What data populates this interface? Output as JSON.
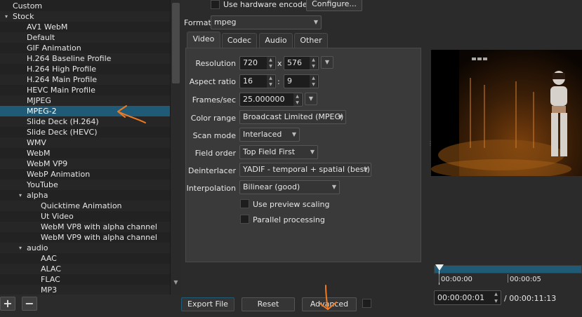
{
  "presets": {
    "items": [
      {
        "label": "Custom",
        "level": 0,
        "arrow": "",
        "selected": false
      },
      {
        "label": "Stock",
        "level": 0,
        "arrow": "▾",
        "selected": false
      },
      {
        "label": "AV1 WebM",
        "level": 1,
        "arrow": "",
        "selected": false
      },
      {
        "label": "Default",
        "level": 1,
        "arrow": "",
        "selected": false
      },
      {
        "label": "GIF Animation",
        "level": 1,
        "arrow": "",
        "selected": false
      },
      {
        "label": "H.264 Baseline Profile",
        "level": 1,
        "arrow": "",
        "selected": false
      },
      {
        "label": "H.264 High Profile",
        "level": 1,
        "arrow": "",
        "selected": false
      },
      {
        "label": "H.264 Main Profile",
        "level": 1,
        "arrow": "",
        "selected": false
      },
      {
        "label": "HEVC Main Profile",
        "level": 1,
        "arrow": "",
        "selected": false
      },
      {
        "label": "MJPEG",
        "level": 1,
        "arrow": "",
        "selected": false
      },
      {
        "label": "MPEG-2",
        "level": 1,
        "arrow": "",
        "selected": true
      },
      {
        "label": "Slide Deck (H.264)",
        "level": 1,
        "arrow": "",
        "selected": false
      },
      {
        "label": "Slide Deck (HEVC)",
        "level": 1,
        "arrow": "",
        "selected": false
      },
      {
        "label": "WMV",
        "level": 1,
        "arrow": "",
        "selected": false
      },
      {
        "label": "WebM",
        "level": 1,
        "arrow": "",
        "selected": false
      },
      {
        "label": "WebM VP9",
        "level": 1,
        "arrow": "",
        "selected": false
      },
      {
        "label": "WebP Animation",
        "level": 1,
        "arrow": "",
        "selected": false
      },
      {
        "label": "YouTube",
        "level": 1,
        "arrow": "",
        "selected": false
      },
      {
        "label": "alpha",
        "level": 1,
        "arrow": "▾",
        "selected": false
      },
      {
        "label": "Quicktime Animation",
        "level": 2,
        "arrow": "",
        "selected": false
      },
      {
        "label": "Ut Video",
        "level": 2,
        "arrow": "",
        "selected": false
      },
      {
        "label": "WebM VP8 with alpha channel",
        "level": 2,
        "arrow": "",
        "selected": false
      },
      {
        "label": "WebM VP9 with alpha channel",
        "level": 2,
        "arrow": "",
        "selected": false
      },
      {
        "label": "audio",
        "level": 1,
        "arrow": "▾",
        "selected": false
      },
      {
        "label": "AAC",
        "level": 2,
        "arrow": "",
        "selected": false
      },
      {
        "label": "ALAC",
        "level": 2,
        "arrow": "",
        "selected": false
      },
      {
        "label": "FLAC",
        "level": 2,
        "arrow": "",
        "selected": false
      },
      {
        "label": "MP3",
        "level": 2,
        "arrow": "",
        "selected": false
      }
    ],
    "add_label": "+",
    "remove_label": "−"
  },
  "top": {
    "hw_encoder_label": "Use hardware encoder",
    "configure_label": "Configure...",
    "format_label": "Format",
    "format_value": "mpeg"
  },
  "tabs": [
    {
      "label": "Video",
      "active": true
    },
    {
      "label": "Codec",
      "active": false
    },
    {
      "label": "Audio",
      "active": false
    },
    {
      "label": "Other",
      "active": false
    }
  ],
  "video": {
    "resolution_label": "Resolution",
    "width": "720",
    "x_sep": "x",
    "height": "576",
    "aspect_label": "Aspect ratio",
    "aspect_w": "16",
    "colon": ":",
    "aspect_h": "9",
    "fps_label": "Frames/sec",
    "fps": "25.000000",
    "color_range_label": "Color range",
    "color_range": "Broadcast Limited (MPEG)",
    "scan_mode_label": "Scan mode",
    "scan_mode": "Interlaced",
    "field_order_label": "Field order",
    "field_order": "Top Field First",
    "deinterlacer_label": "Deinterlacer",
    "deinterlacer": "YADIF - temporal + spatial (best)",
    "interpolation_label": "Interpolation",
    "interpolation": "Bilinear (good)",
    "preview_scaling_label": "Use preview scaling",
    "parallel_label": "Parallel processing"
  },
  "actions": {
    "export_label": "Export File",
    "reset_label": "Reset",
    "advanced_label": "Advanced"
  },
  "player": {
    "tick_start": "00:00:00",
    "tick_5": "00:00:05",
    "current_time": "00:00:00:01",
    "total_time": "/ 00:00:11:13"
  },
  "colors": {
    "selection": "#1f5b77",
    "annotation": "#f07a22"
  }
}
